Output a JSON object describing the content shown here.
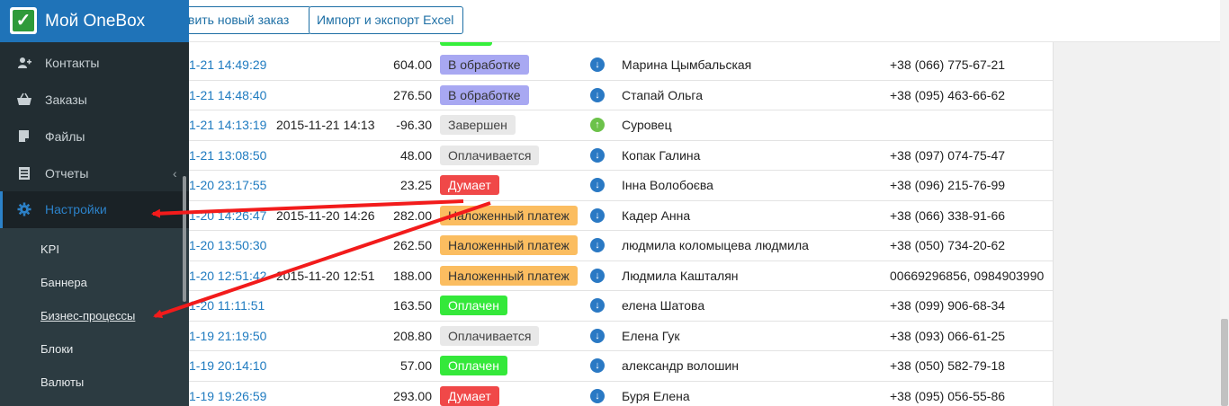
{
  "brand": {
    "title": "Мой OneBox",
    "logo_icon": "checkmark-icon"
  },
  "toolbar": {
    "new_order_label": "вить новый заказ",
    "import_label": "Импорт и экспорт Excel"
  },
  "sidebar": {
    "items": [
      {
        "label": "Контакты",
        "icon": "contacts-icon"
      },
      {
        "label": "Заказы",
        "icon": "basket-icon"
      },
      {
        "label": "Файлы",
        "icon": "files-icon"
      },
      {
        "label": "Отчеты",
        "icon": "reports-icon"
      },
      {
        "label": "Настройки",
        "icon": "gear-icon",
        "active": true
      }
    ],
    "reports_chevron": "‹",
    "submenu": [
      {
        "label": "KPI"
      },
      {
        "label": "Баннера"
      },
      {
        "label": "Бизнес-процессы",
        "highlighted": true
      },
      {
        "label": "Блоки"
      },
      {
        "label": "Валюты"
      }
    ]
  },
  "status_colors": {
    "В обработке": "#a8a8f2",
    "Завершен": "#e8e8e8",
    "Оплачивается": "#e8e8e8",
    "Думает": "#f04848",
    "Наложенный платеж": "#fbbd60",
    "Оплачен": "#34e83a"
  },
  "orders": [
    {
      "date": "1-21 14:49:29",
      "closed": "",
      "sum": "604.00",
      "status": "В обработке",
      "direction": "in",
      "name": "Марина Цымбальская",
      "phone": "+38 (066) 775-67-21"
    },
    {
      "date": "1-21 14:48:40",
      "closed": "",
      "sum": "276.50",
      "status": "В обработке",
      "direction": "in",
      "name": "Стапай Ольга",
      "phone": "+38 (095) 463-66-62"
    },
    {
      "date": "1-21 14:13:19",
      "closed": "2015-11-21 14:13",
      "sum": "-96.30",
      "status": "Завершен",
      "direction": "out",
      "name": "Суровец",
      "phone": ""
    },
    {
      "date": "1-21 13:08:50",
      "closed": "",
      "sum": "48.00",
      "status": "Оплачивается",
      "direction": "in",
      "name": "Копак Галина",
      "phone": "+38 (097) 074-75-47"
    },
    {
      "date": "1-20 23:17:55",
      "closed": "",
      "sum": "23.25",
      "status": "Думает",
      "direction": "in",
      "name": "Інна Волобоєва",
      "phone": "+38 (096) 215-76-99"
    },
    {
      "date": "1-20 14:26:47",
      "closed": "2015-11-20 14:26",
      "sum": "282.00",
      "status": "Наложенный платеж",
      "direction": "in",
      "name": "Кадер Анна",
      "phone": "+38 (066) 338-91-66"
    },
    {
      "date": "1-20 13:50:30",
      "closed": "",
      "sum": "262.50",
      "status": "Наложенный платеж",
      "direction": "in",
      "name": "людмила коломыцева людмила",
      "phone": "+38 (050) 734-20-62"
    },
    {
      "date": "1-20 12:51:42",
      "closed": "2015-11-20 12:51",
      "sum": "188.00",
      "status": "Наложенный платеж",
      "direction": "in",
      "name": "Людмила Кашталян",
      "phone": "00669296856, 0984903990"
    },
    {
      "date": "1-20 11:11:51",
      "closed": "",
      "sum": "163.50",
      "status": "Оплачен",
      "direction": "in",
      "name": "елена Шатова",
      "phone": "+38 (099) 906-68-34"
    },
    {
      "date": "1-19 21:19:50",
      "closed": "",
      "sum": "208.80",
      "status": "Оплачивается",
      "direction": "in",
      "name": "Елена Гук",
      "phone": "+38 (093) 066-61-25"
    },
    {
      "date": "1-19 20:14:10",
      "closed": "",
      "sum": "57.00",
      "status": "Оплачен",
      "direction": "in",
      "name": "александр волошин",
      "phone": "+38 (050) 582-79-18"
    },
    {
      "date": "1-19 19:26:59",
      "closed": "",
      "sum": "293.00",
      "status": "Думает",
      "direction": "in",
      "name": "Буря Елена",
      "phone": "+38 (095) 056-55-86"
    }
  ],
  "annotation_color": "#f21b1b"
}
